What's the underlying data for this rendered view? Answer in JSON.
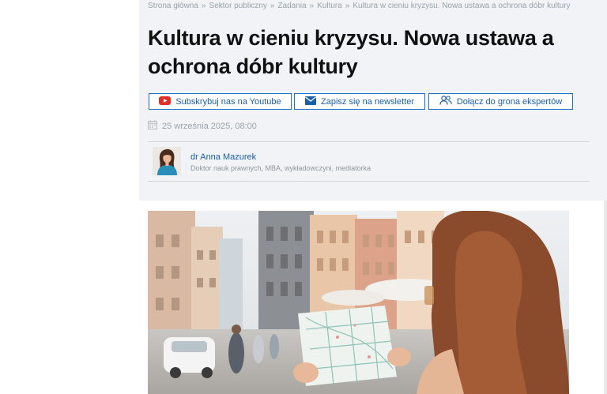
{
  "breadcrumb": {
    "items": [
      "Strona główna",
      "Sektor publiczny",
      "Zadania",
      "Kultura",
      "Kultura w cieniu kryzysu. Nowa ustawa a ochrona dóbr kultury"
    ],
    "separator": "»"
  },
  "article": {
    "title": "Kultura w cieniu kryzysu. Nowa ustawa a ochrona dóbr kultury",
    "date": "25 września 2025, 08:00"
  },
  "actions": {
    "youtube_label": "Subskrybuj nas na Youtube",
    "newsletter_label": "Zapisz się na newsletter",
    "experts_label": "Dołącz do grona ekspertów"
  },
  "author": {
    "name": "dr Anna Mazurek",
    "description": "Doktor nauk prawnych, MBA, wykładowczyni, mediatorka"
  },
  "colors": {
    "accent": "#1a73c7",
    "youtube": "#e52d27",
    "header_bg": "#f1f3f6"
  }
}
